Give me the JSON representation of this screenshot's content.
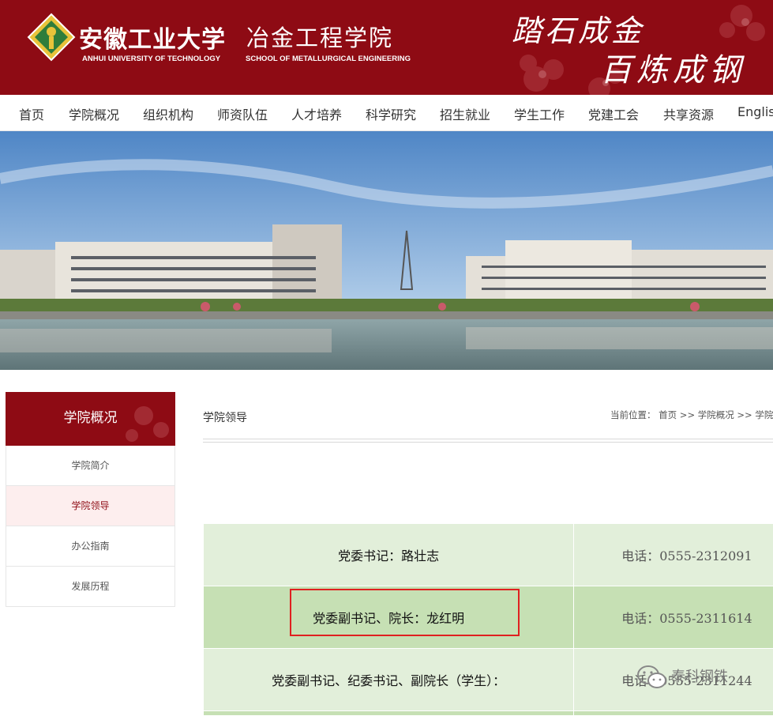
{
  "header": {
    "university_cn": "安徽工业大学",
    "university_en": "ANHUI UNIVERSITY OF TECHNOLOGY",
    "school_cn": "冶金工程学院",
    "school_en": "SCHOOL OF METALLURGICAL ENGINEERING",
    "motto_line1": "踏石成金",
    "motto_line2": "百炼成钢",
    "brand_color": "#8e0b14"
  },
  "nav": {
    "items": [
      "首页",
      "学院概况",
      "组织机构",
      "师资队伍",
      "人才培养",
      "科学研究",
      "招生就业",
      "学生工作",
      "党建工会",
      "共享资源",
      "English"
    ]
  },
  "sidebar": {
    "title": "学院概况",
    "items": [
      {
        "label": "学院简介",
        "active": false
      },
      {
        "label": "学院领导",
        "active": true
      },
      {
        "label": "办公指南",
        "active": false
      },
      {
        "label": "发展历程",
        "active": false
      }
    ]
  },
  "main": {
    "title": "学院领导",
    "breadcrumb": "当前位置： 首页 >> 学院概况 >> 学院领导"
  },
  "leaders": [
    {
      "role": "党委书记：路壮志",
      "phone": "电话：0555-2312091"
    },
    {
      "role": "党委副书记、院长：龙红明",
      "phone": "电话：0555-2311614"
    },
    {
      "role": "党委副书记、纪委书记、副院长（学生）：",
      "phone": "电话：0555-2311244"
    }
  ],
  "watermark": "泰科钢铁",
  "colors": {
    "row_light": "#e2efda",
    "row_dark": "#c6e0b4",
    "highlight_box": "#e02020"
  }
}
